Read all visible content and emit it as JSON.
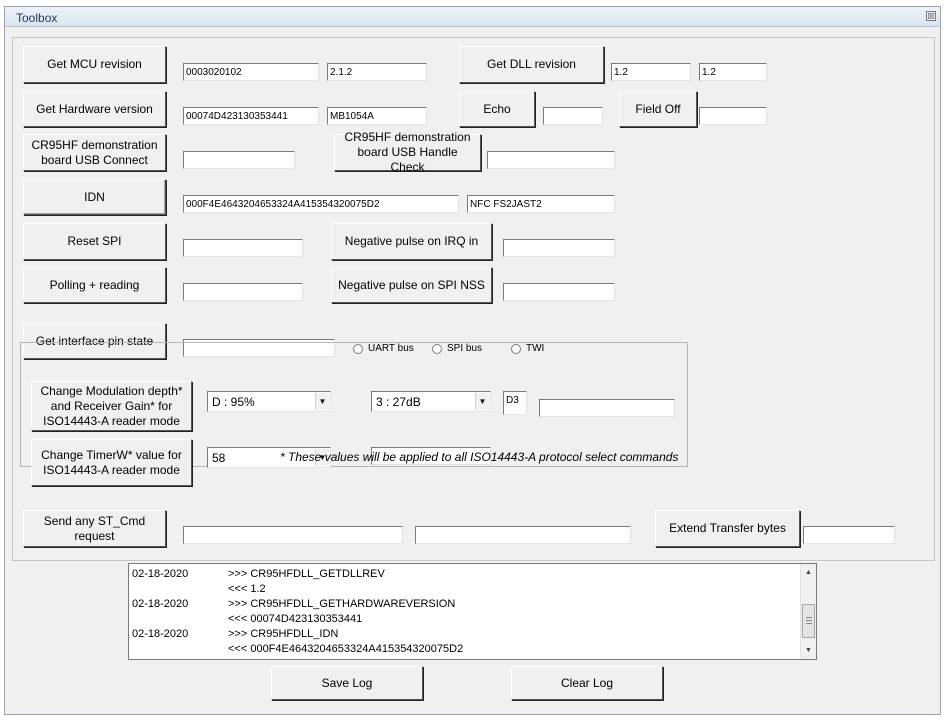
{
  "window": {
    "title": "Toolbox",
    "close_glyph": "☒"
  },
  "row1": {
    "get_mcu_label": "Get MCU revision",
    "mcu_value1": "0003020102",
    "mcu_value2": "2.1.2",
    "get_dll_label": "Get DLL revision",
    "dll_value1": "1.2",
    "dll_value2": "1.2"
  },
  "row2": {
    "get_hw_label": "Get Hardware version",
    "hw_value1": "00074D423130353441",
    "hw_value2": "MB1054A",
    "echo_label": "Echo",
    "echo_value": "",
    "field_off_label": "Field Off",
    "field_off_value": ""
  },
  "row3": {
    "usb_connect_label": "CR95HF demonstration board USB Connect",
    "usb_connect_value": "",
    "usb_handle_label": "CR95HF demonstration board USB Handle Check",
    "usb_handle_value": ""
  },
  "row4": {
    "idn_label": "IDN",
    "idn_value1": "000F4E4643204653324A415354320075D2",
    "idn_value2": "NFC FS2JAST2"
  },
  "row5": {
    "reset_spi_label": "Reset SPI",
    "reset_spi_value": "",
    "neg_irq_label": "Negative pulse on IRQ in",
    "neg_irq_value": ""
  },
  "row6": {
    "polling_label": "Polling + reading",
    "polling_value": "",
    "neg_nss_label": "Negative pulse on SPI NSS",
    "neg_nss_value": ""
  },
  "row7": {
    "pin_state_label": "Get interface pin state",
    "pin_state_value": "",
    "radio_uart": "UART bus",
    "radio_spi": "SPI bus",
    "radio_twi": "TWI"
  },
  "modulation": {
    "change_mod_label": "Change Modulation depth* and Receiver Gain* for ISO14443-A reader mode",
    "depth_selected": "D : 95%",
    "gain_selected": "3 : 27dB",
    "code_value": "D3",
    "result_value": "",
    "change_timer_label": "Change TimerW* value for ISO14443-A reader mode",
    "timer_selected": "58",
    "timer_result": "",
    "note": "* These values will be applied to all ISO14443-A protocol select commands"
  },
  "row_st": {
    "send_st_label": "Send any ST_Cmd request",
    "st_value1": "",
    "st_value2": "",
    "extend_label": "Extend Transfer bytes",
    "extend_value": ""
  },
  "log": {
    "entries": [
      {
        "date": "02-18-2020",
        "text": ">>> CR95HFDLL_GETDLLREV"
      },
      {
        "date": "",
        "text": "<<< 1.2"
      },
      {
        "date": "02-18-2020",
        "text": ">>> CR95HFDLL_GETHARDWAREVERSION"
      },
      {
        "date": "",
        "text": "<<< 00074D423130353441"
      },
      {
        "date": "02-18-2020",
        "text": ">>> CR95HFDLL_IDN"
      },
      {
        "date": "",
        "text": "<<< 000F4E4643204653324A415354320075D2"
      }
    ]
  },
  "footer": {
    "save_log_label": "Save Log",
    "clear_log_label": "Clear Log"
  }
}
